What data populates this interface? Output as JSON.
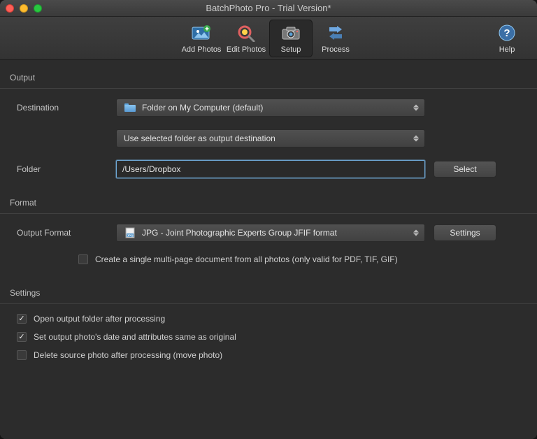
{
  "window": {
    "title": "BatchPhoto Pro - Trial Version*"
  },
  "toolbar": {
    "items": [
      {
        "label": "Add Photos"
      },
      {
        "label": "Edit Photos"
      },
      {
        "label": "Setup"
      },
      {
        "label": "Process"
      }
    ],
    "help": "Help"
  },
  "sections": {
    "output": {
      "title": "Output",
      "destination_label": "Destination",
      "destination_value": "Folder on My Computer (default)",
      "destination_mode": "Use selected folder as output destination",
      "folder_label": "Folder",
      "folder_value": "/Users/Dropbox",
      "select_btn": "Select"
    },
    "format": {
      "title": "Format",
      "output_format_label": "Output Format",
      "output_format_value": "JPG - Joint Photographic Experts Group JFIF format",
      "settings_btn": "Settings",
      "multipage_label": "Create a single multi-page document from all photos (only valid for PDF, TIF, GIF)",
      "multipage_checked": false
    },
    "settings": {
      "title": "Settings",
      "open_folder_label": "Open output folder after processing",
      "open_folder_checked": true,
      "preserve_date_label": "Set output photo's date and attributes same as original",
      "preserve_date_checked": true,
      "delete_source_label": "Delete source photo after processing (move photo)",
      "delete_source_checked": false
    }
  }
}
